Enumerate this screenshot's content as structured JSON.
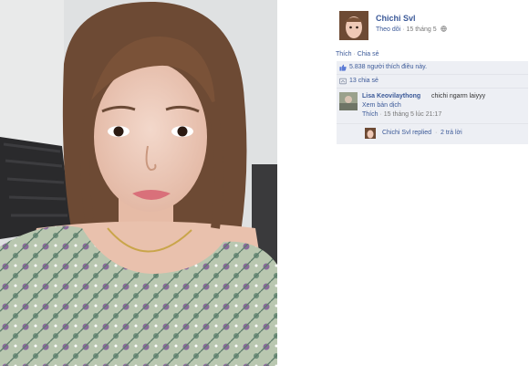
{
  "post": {
    "author": "Chichi Svl",
    "follow_label": "Theo dõi",
    "separator": "·",
    "date": "15 tháng 5",
    "privacy_icon": "globe-icon"
  },
  "actions": {
    "like_label": "Thích",
    "separator": "·",
    "share_label": "Chia sẻ"
  },
  "likes": {
    "icon": "thumbs-up-icon",
    "text": "5.838 người thích điều này."
  },
  "shares": {
    "icon": "share-icon",
    "text": "13 chia sẻ"
  },
  "comment": {
    "author": "Lisa Keovilaythong",
    "text": "chichi ngarm laiyyy",
    "translate_label": "Xem bản dịch",
    "like_label": "Thích",
    "separator": "·",
    "timestamp": "15 tháng 5 lúc 21:17"
  },
  "reply": {
    "text": "Chichi Svl replied",
    "separator": "·",
    "count": "2 trả lời"
  },
  "colors": {
    "link": "#3b5998",
    "panel_bg": "#edeff4"
  }
}
